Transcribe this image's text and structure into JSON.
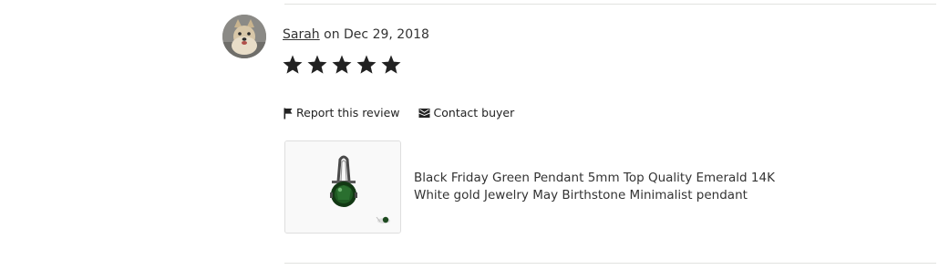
{
  "review": {
    "reviewer_name": "Sarah",
    "date_text": " on Dec 29, 2018",
    "rating": 5,
    "rating_max": 5,
    "star_color": "#222222"
  },
  "actions": {
    "report_label": "Report this review",
    "report_icon": "flag-icon",
    "contact_label": "Contact buyer",
    "contact_icon": "envelope-icon"
  },
  "listing": {
    "title_line1": "Black Friday Green Pendant 5mm Top Quality Emerald 14K",
    "title_line2": "White gold Jewelry May Birthstone Minimalist pendant"
  }
}
